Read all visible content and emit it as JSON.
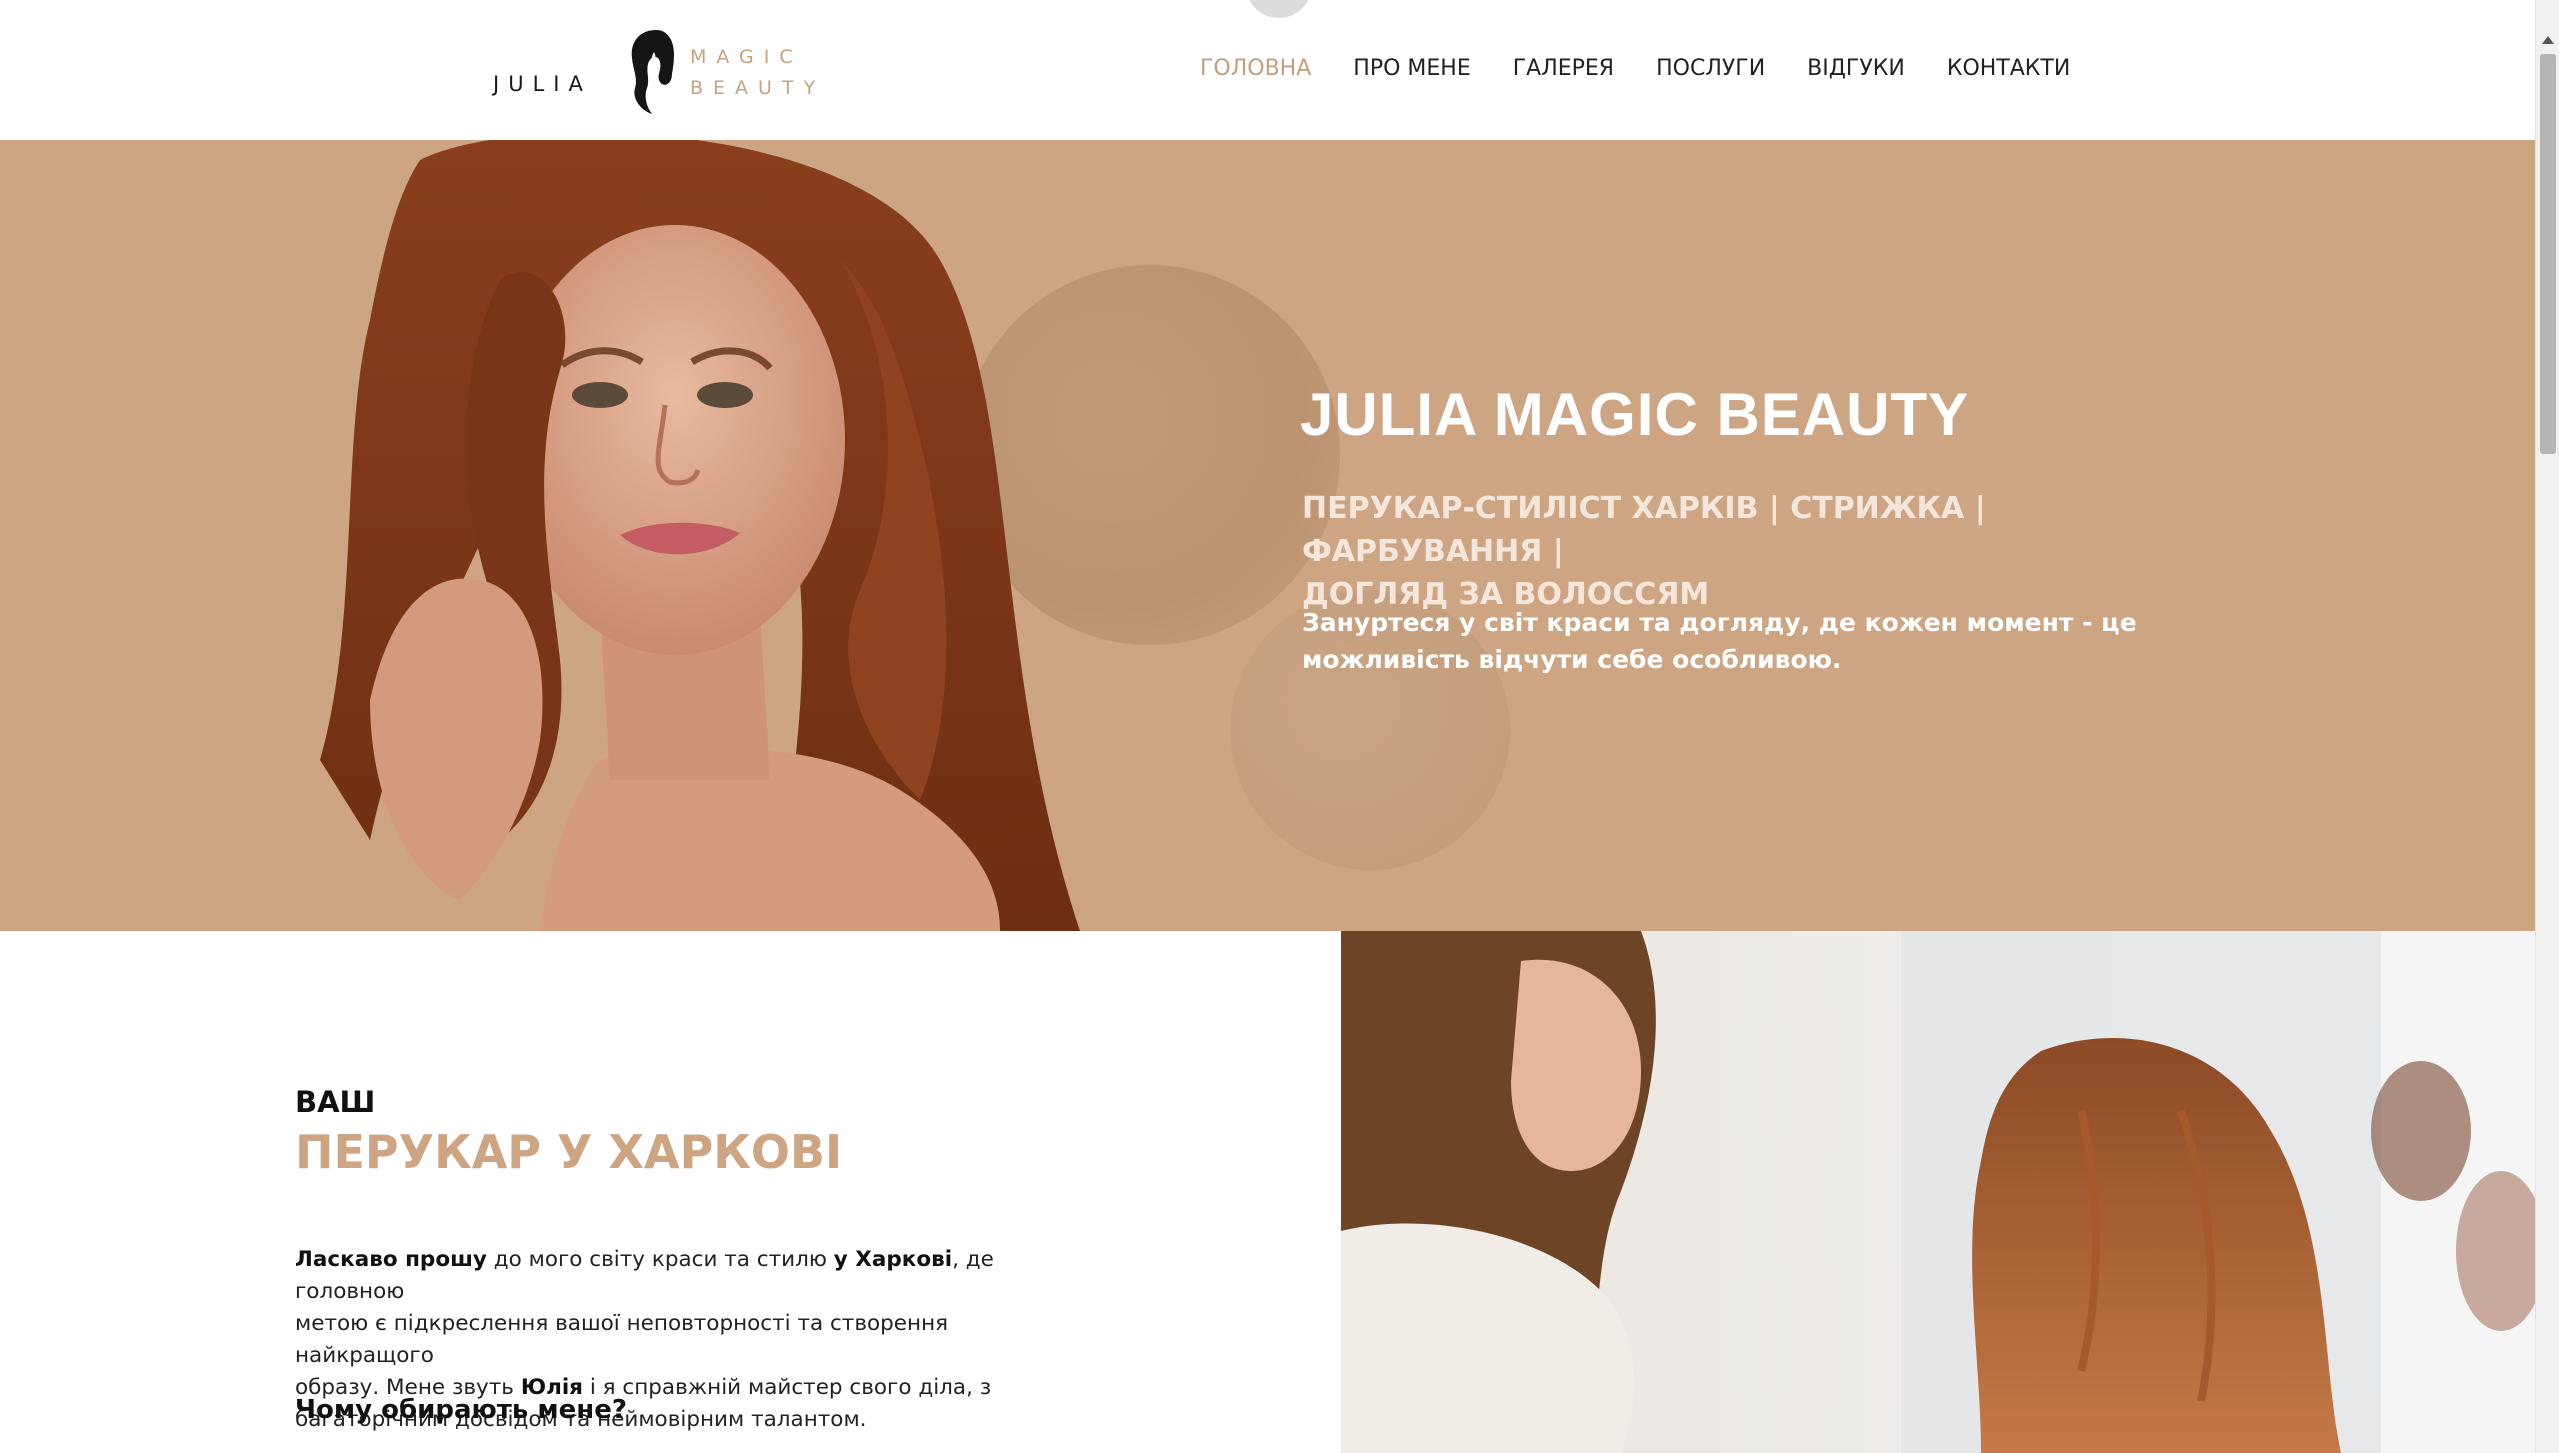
{
  "brand": {
    "logo_left": "JULIA",
    "logo_right_line1": "MAGIC",
    "logo_right_line2": "BEAUTY",
    "accent_color": "#c59d7a",
    "hero_bg_color": "#cda583"
  },
  "nav": {
    "items": [
      {
        "label": "ГОЛОВНА",
        "active": true
      },
      {
        "label": "ПРО МЕНЕ",
        "active": false
      },
      {
        "label": "ГАЛЕРЕЯ",
        "active": false
      },
      {
        "label": "ПОСЛУГИ",
        "active": false
      },
      {
        "label": "ВІДГУКИ",
        "active": false
      },
      {
        "label": "КОНТАКТИ",
        "active": false
      }
    ]
  },
  "hero": {
    "title": "JULIA MAGIC BEAUTY",
    "subtitle_line1": "ПЕРУКАР-СТИЛІСТ ХАРКІВ | СТРИЖКА | ФАРБУВАННЯ |",
    "subtitle_line2": "ДОГЛЯД ЗА ВОЛОССЯМ",
    "description_line1": "Зануртеся у світ краси та догляду, де кожен момент - це",
    "description_line2": "можливість відчути себе особливою."
  },
  "about": {
    "heading_small": "ВАШ",
    "heading_big": "ПЕРУКАР У ХАРКОВІ",
    "p1_bold1": "Ласкаво прошу",
    "p1_t1": " до мого світу краси та стилю ",
    "p1_bold2": "у Харкові",
    "p1_t2": ", де головною",
    "p1_line2": "метою є підкреслення вашої неповторності та створення найкращого",
    "p1_line3a": "образу. Мене звуть ",
    "p1_bold3": "Юлія",
    "p1_line3b": " і я справжній майстер свого діла, з",
    "p1_line4": "багаторічним досвідом та неймовірним талантом.",
    "question": "Чому обирають мене?"
  }
}
